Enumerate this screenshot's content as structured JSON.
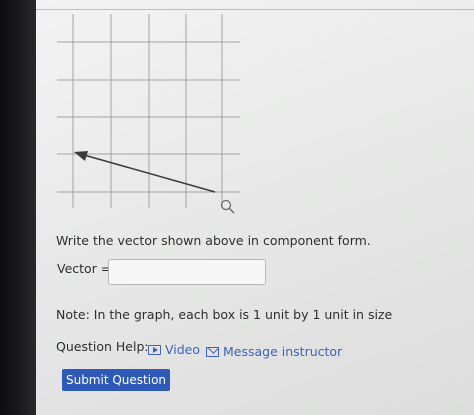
{
  "question": {
    "prompt": "Write the vector shown above in component form.",
    "vector_label": "Vector =",
    "vector_value": "",
    "note": "Note: In the graph, each box is 1 unit by 1 unit in size"
  },
  "help": {
    "label": "Question Help:",
    "video_label": "Video",
    "message_label": "Message instructor"
  },
  "submit_label": "Submit Question",
  "colors": {
    "link": "#3f63b8",
    "button": "#2e59b8",
    "grid": "#9a9a9a",
    "vector": "#3a3a3a"
  },
  "icons": [
    "magnifier-icon",
    "video-icon",
    "mail-icon"
  ]
}
